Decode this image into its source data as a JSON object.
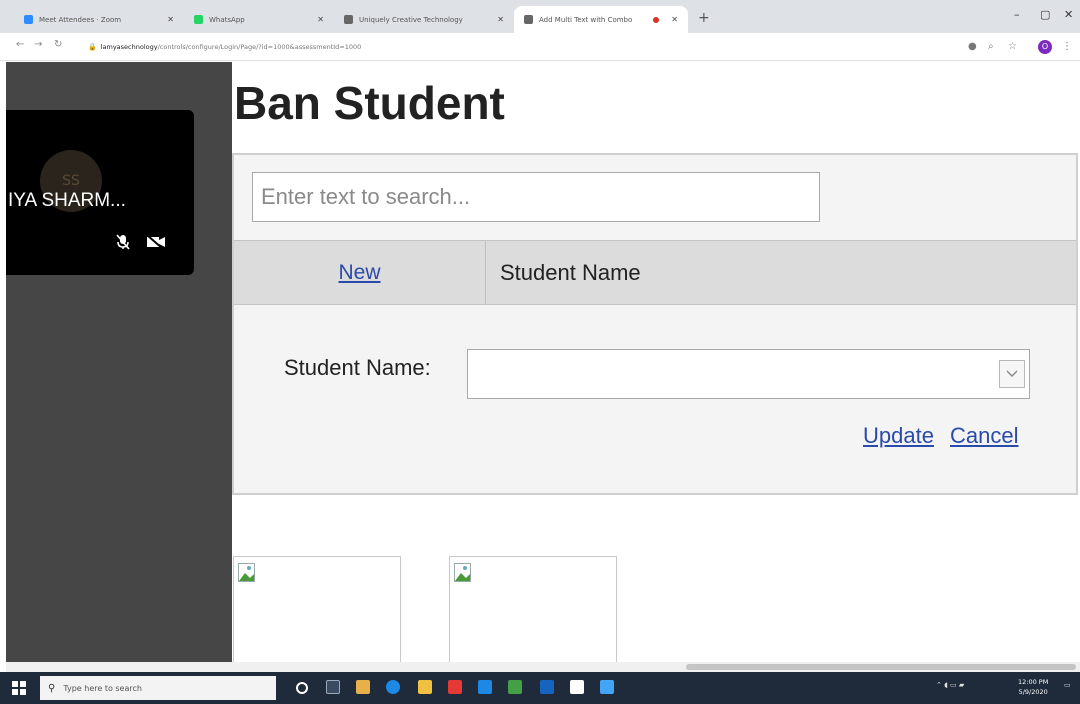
{
  "browser": {
    "tabs": [
      {
        "label": "Meet Attendees · Zoom",
        "active": false
      },
      {
        "label": "WhatsApp",
        "active": false
      },
      {
        "label": "Uniquely Creative Technology",
        "active": false
      },
      {
        "label": "Add Multi Text with Combo",
        "active": true
      }
    ],
    "address": {
      "host": "lamyasechnology",
      "path": "/controls/configure/Login/Page/?id=1000&assessmentId=1000"
    },
    "profile_initial": "O"
  },
  "meeting": {
    "participant_name": "IYA SHARM...",
    "avatar_initials": "SS"
  },
  "page": {
    "title": "Ban Student",
    "search": {
      "placeholder": "Enter text to search..."
    },
    "grid": {
      "new_link": "New",
      "column_header": "Student Name"
    },
    "edit_form": {
      "field_label": "Student Name:",
      "field_value": "",
      "update_link": "Update",
      "cancel_link": "Cancel"
    }
  },
  "taskbar": {
    "search_placeholder": "Type here to search",
    "clock_time": "12:00 PM",
    "clock_date": "5/9/2020"
  },
  "colors": {
    "link": "#2a4bab",
    "side_panel": "#464646",
    "taskbar": "#1f2a3a"
  }
}
